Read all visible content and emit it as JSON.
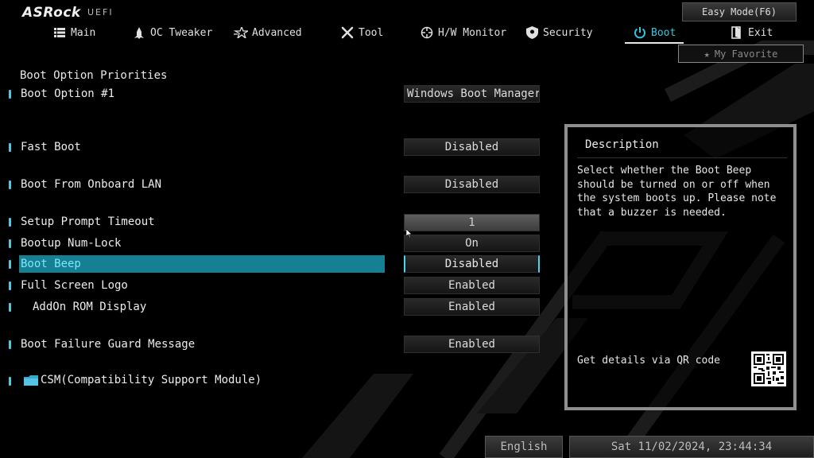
{
  "header": {
    "brand": "ASRock",
    "brand_sub": "UEFI",
    "easy_mode_label": "Easy Mode(F6)",
    "favorite_label": "My Favorite"
  },
  "nav": [
    {
      "label": "Main",
      "icon": "list-icon"
    },
    {
      "label": "OC Tweaker",
      "icon": "rocket-icon"
    },
    {
      "label": "Advanced",
      "icon": "star-advanced-icon"
    },
    {
      "label": "Tool",
      "icon": "tools-icon"
    },
    {
      "label": "H/W Monitor",
      "icon": "crosshair-icon"
    },
    {
      "label": "Security",
      "icon": "shield-icon"
    },
    {
      "label": "Boot",
      "icon": "power-icon",
      "active": true
    },
    {
      "label": "Exit",
      "icon": "exit-icon"
    }
  ],
  "main": {
    "section_title": "Boot Option Priorities",
    "options": [
      {
        "label": "Boot Option #1",
        "value": "Windows Boot Manager ..."
      },
      {
        "label": "Fast Boot",
        "value": "Disabled"
      },
      {
        "label": "Boot From Onboard LAN",
        "value": "Disabled"
      },
      {
        "label": "Setup Prompt Timeout",
        "value": "1"
      },
      {
        "label": "Bootup Num-Lock",
        "value": "On"
      },
      {
        "label": "Boot Beep",
        "value": "Disabled",
        "selected": true
      },
      {
        "label": "Full Screen Logo",
        "value": "Enabled"
      },
      {
        "label": "AddOn ROM Display",
        "value": "Enabled"
      },
      {
        "label": "Boot Failure Guard Message",
        "value": "Enabled"
      },
      {
        "label": "CSM(Compatibility Support Module)",
        "icon": "folder-icon"
      }
    ]
  },
  "description": {
    "title": "Description",
    "text": "Select whether the Boot Beep should be turned on or off when the system boots up. Please note that a buzzer is needed.",
    "qr_label": "Get details via QR code"
  },
  "footer": {
    "language": "English",
    "datetime": "Sat 11/02/2024, 23:44:34"
  },
  "colors": {
    "accent": "#36c6e0",
    "selected_row": "#167f93",
    "background": "#000000"
  }
}
